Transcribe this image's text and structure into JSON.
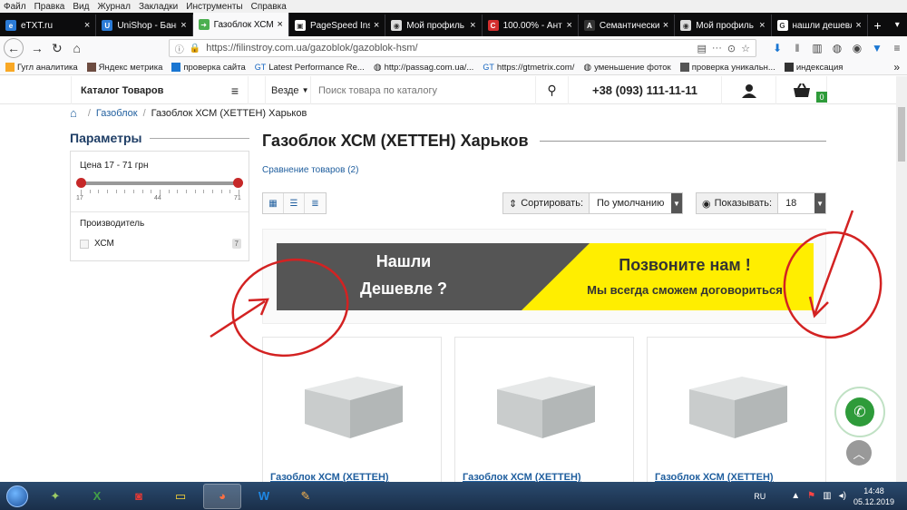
{
  "menu": [
    "Файл",
    "Правка",
    "Вид",
    "Журнал",
    "Закладки",
    "Инструменты",
    "Справка"
  ],
  "tabs": [
    {
      "title": "eTXT.ru",
      "color": "#2b7bd6",
      "glyph": "e"
    },
    {
      "title": "UniShop - Банн",
      "color": "#2b7bd6",
      "glyph": "U"
    },
    {
      "title": "Газоблок ХСМ (",
      "color": "#4caf50",
      "glyph": "➜",
      "active": true
    },
    {
      "title": "PageSpeed Insig",
      "color": "#fff",
      "glyph": "▣"
    },
    {
      "title": "Мой профиль -",
      "color": "#ddd",
      "glyph": "◉"
    },
    {
      "title": "100.00% - Анти",
      "color": "#d32f2f",
      "glyph": "C"
    },
    {
      "title": "Семантический",
      "color": "#333",
      "glyph": "A"
    },
    {
      "title": "Мой профиль -",
      "color": "#ddd",
      "glyph": "◉"
    },
    {
      "title": "нашли дешевл",
      "color": "#fff",
      "glyph": "G"
    }
  ],
  "address": {
    "url": "https://filinstroy.com.ua/gazoblok/gazoblok-hsm/"
  },
  "bookmarks": [
    {
      "label": "Гугл аналитика",
      "color": "#f9a825"
    },
    {
      "label": "Яндекс метрика",
      "color": "#6d4c41"
    },
    {
      "label": "проверка сайта",
      "color": "#1976d2"
    },
    {
      "label": "Latest Performance Re...",
      "prefix": "GT"
    },
    {
      "label": "http://passag.com.ua/...",
      "globe": true
    },
    {
      "label": "https://gtmetrix.com/",
      "prefix": "GT"
    },
    {
      "label": "уменьшение фоток",
      "globe": true
    },
    {
      "label": "проверка уникальн...",
      "color": "#555"
    },
    {
      "label": "индексация",
      "color": "#333"
    }
  ],
  "header": {
    "catalog": "Каталог Товаров",
    "scope": "Везде",
    "search_placeholder": "Поиск товара по каталогу",
    "phone": "+38 (093) 111-11-11",
    "cart_count": "0"
  },
  "breadcrumb": {
    "items": [
      "Газоблок",
      "Газоблок ХСМ (ХЕТТЕН) Харьков"
    ]
  },
  "filters": {
    "title": "Параметры",
    "price_label": "Цена  17 - 71 грн",
    "price_min": 17,
    "price_mid": 44,
    "price_max": 71,
    "tick_min": "17",
    "tick_mid": "44",
    "tick_max": "71",
    "manufacturer_title": "Производитель",
    "manufacturer": {
      "name": "ХСМ",
      "count": "7"
    }
  },
  "main": {
    "title": "Газоблок ХСМ (ХЕТТЕН) Харьков",
    "compare": "Сравнение товаров (2)",
    "sort_label": "Сортировать:",
    "sort_value": "По умолчанию",
    "show_label": "Показывать:",
    "show_value": "18"
  },
  "banner": {
    "left_line1": "Нашли",
    "left_line2": "Дешевле ?",
    "right_line1": "Позвоните нам !",
    "right_line2": "Мы всегда сможем договориться",
    "dark": "#555555",
    "yellow": "#ffee00"
  },
  "products": [
    {
      "name": "Газоблок ХСМ (ХЕТТЕН)"
    },
    {
      "name": "Газоблок ХСМ (ХЕТТЕН)"
    },
    {
      "name": "Газоблок ХСМ (ХЕТТЕН)"
    }
  ],
  "taskbar": {
    "lang": "RU",
    "time": "14:48",
    "date": "05.12.2019"
  }
}
